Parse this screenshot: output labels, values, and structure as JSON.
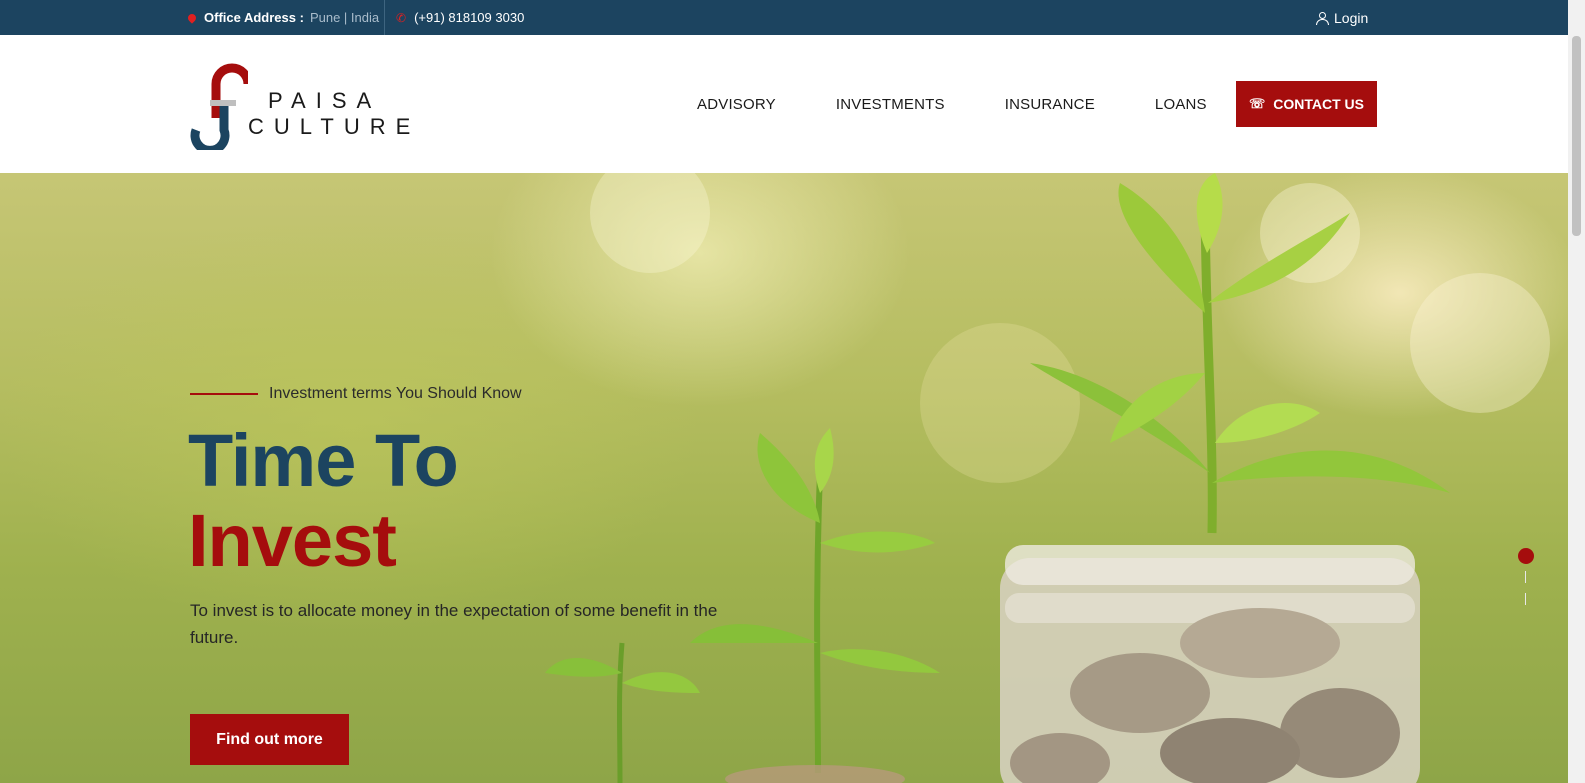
{
  "topbar": {
    "address_label": "Office Address :",
    "address_value": "Pune | India",
    "phone": "(+91) 818109 3030",
    "login": "Login"
  },
  "header": {
    "logo_line1": "PAISA",
    "logo_line2": "CULTURE",
    "nav": [
      "ADVISORY",
      "INVESTMENTS",
      "INSURANCE",
      "LOANS"
    ],
    "contact": "CONTACT US"
  },
  "hero": {
    "eyebrow": "Investment terms You Should Know",
    "title_line1": "Time To",
    "title_line2": "Invest",
    "description": "To invest is to allocate money in the expectation of some benefit in the future.",
    "cta": "Find out more"
  },
  "colors": {
    "navy": "#1c4460",
    "red": "#a50d0d",
    "topbar": "#1c4460"
  }
}
